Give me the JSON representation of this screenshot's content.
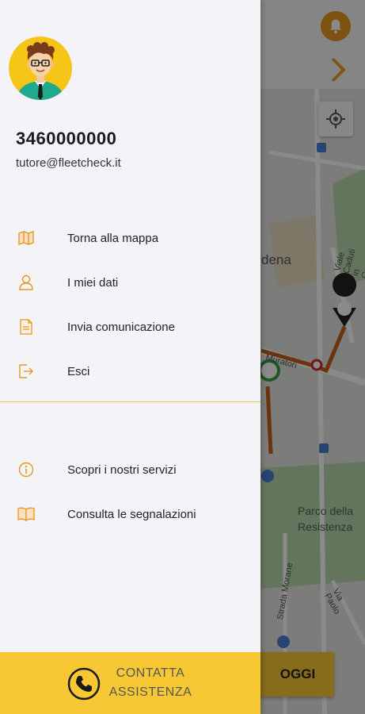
{
  "user": {
    "phone": "3460000000",
    "email": "tutore@fleetcheck.it"
  },
  "menu_primary": [
    {
      "label": "Torna alla mappa",
      "icon": "map-icon"
    },
    {
      "label": "I miei dati",
      "icon": "user-icon"
    },
    {
      "label": "Invia comunicazione",
      "icon": "send-document-icon"
    },
    {
      "label": "Esci",
      "icon": "logout-icon"
    }
  ],
  "menu_secondary": [
    {
      "label": "Scopri i nostri servizi",
      "icon": "info-icon"
    },
    {
      "label": "Consulta le segnalazioni",
      "icon": "book-icon"
    }
  ],
  "assistance": {
    "line1": "CONTATTA",
    "line2": "ASSISTENZA",
    "icon": "phone-icon"
  },
  "map": {
    "labels": [
      "dena",
      "Viale Caduti in Guerra",
      "Muratori",
      "Parco della",
      "Resistenza",
      "Strada Morane",
      "Via Paolo"
    ],
    "today_button": "OGGI"
  },
  "colors": {
    "accent": "#f7c833",
    "icon_orange": "#e8961c",
    "route": "#c8601a",
    "drawer_bg": "#f4f4f8"
  }
}
